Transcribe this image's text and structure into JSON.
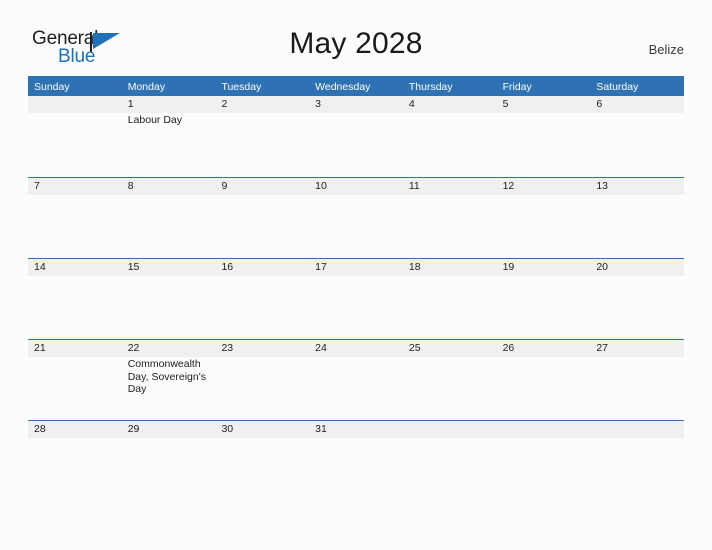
{
  "brand": {
    "name_part1": "General",
    "name_part2": "Blue",
    "flag_icon": "flag-triangle-icon",
    "colors": {
      "dark": "#231f20",
      "blue": "#2072b8"
    }
  },
  "header": {
    "title": "May 2028",
    "region": "Belize"
  },
  "theme": {
    "header_blue": "#2e72b4",
    "band_gray": "#f0f0ee",
    "page_background": "#fcfcfc",
    "text": "#1d1d1d"
  },
  "calendar": {
    "month": "May",
    "year": "2028",
    "weekday_headers": [
      "Sunday",
      "Monday",
      "Tuesday",
      "Wednesday",
      "Thursday",
      "Friday",
      "Saturday"
    ],
    "weeks": [
      [
        {
          "day": "",
          "events": ""
        },
        {
          "day": "1",
          "events": "Labour Day"
        },
        {
          "day": "2",
          "events": ""
        },
        {
          "day": "3",
          "events": ""
        },
        {
          "day": "4",
          "events": ""
        },
        {
          "day": "5",
          "events": ""
        },
        {
          "day": "6",
          "events": ""
        }
      ],
      [
        {
          "day": "7",
          "events": ""
        },
        {
          "day": "8",
          "events": ""
        },
        {
          "day": "9",
          "events": ""
        },
        {
          "day": "10",
          "events": ""
        },
        {
          "day": "11",
          "events": ""
        },
        {
          "day": "12",
          "events": ""
        },
        {
          "day": "13",
          "events": ""
        }
      ],
      [
        {
          "day": "14",
          "events": ""
        },
        {
          "day": "15",
          "events": ""
        },
        {
          "day": "16",
          "events": ""
        },
        {
          "day": "17",
          "events": ""
        },
        {
          "day": "18",
          "events": ""
        },
        {
          "day": "19",
          "events": ""
        },
        {
          "day": "20",
          "events": ""
        }
      ],
      [
        {
          "day": "21",
          "events": ""
        },
        {
          "day": "22",
          "events": "Commonwealth Day, Sovereign's Day"
        },
        {
          "day": "23",
          "events": ""
        },
        {
          "day": "24",
          "events": ""
        },
        {
          "day": "25",
          "events": ""
        },
        {
          "day": "26",
          "events": ""
        },
        {
          "day": "27",
          "events": ""
        }
      ],
      [
        {
          "day": "28",
          "events": ""
        },
        {
          "day": "29",
          "events": ""
        },
        {
          "day": "30",
          "events": ""
        },
        {
          "day": "31",
          "events": ""
        },
        {
          "day": "",
          "events": ""
        },
        {
          "day": "",
          "events": ""
        },
        {
          "day": "",
          "events": ""
        }
      ]
    ]
  }
}
